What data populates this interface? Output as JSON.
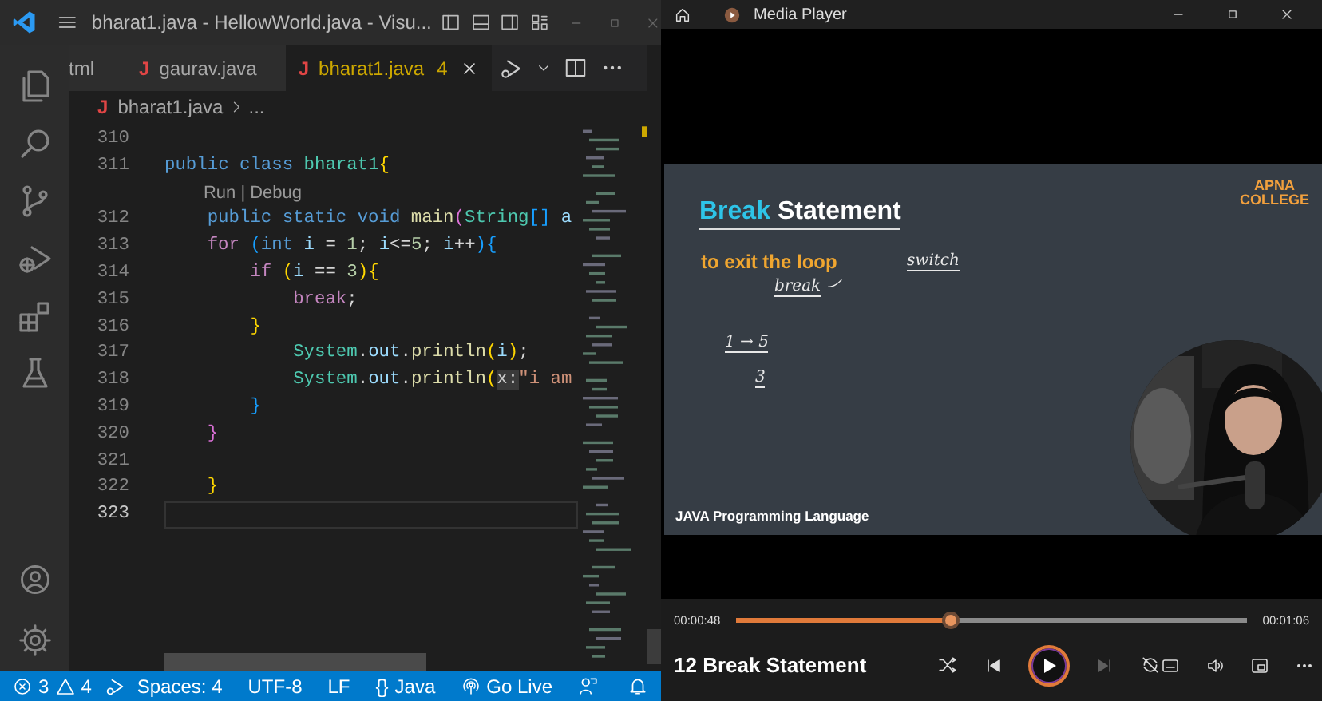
{
  "editor": {
    "title": "bharat1.java - HellowWorld.java - Visu...",
    "tabs": [
      {
        "label": "tml",
        "selected": false
      },
      {
        "icon": "J",
        "label": "gaurav.java",
        "selected": false
      },
      {
        "icon": "J",
        "label": "bharat1.java",
        "badge": "4",
        "selected": true
      }
    ],
    "breadcrumb": {
      "icon": "J",
      "file": "bharat1.java",
      "rest": "..."
    },
    "lines": [
      {
        "number": "310",
        "current": false
      },
      {
        "number": "311",
        "current": false,
        "tokens": [
          {
            "kind": "keyword",
            "text": "public class "
          },
          {
            "kind": "type",
            "text": "bharat1"
          },
          {
            "kind": "bracket1",
            "text": "{"
          }
        ],
        "children": [
          {
            "kind": "codelens",
            "text": "Run | Debug"
          },
          {
            "number": "312",
            "current": false,
            "tokens": [
              {
                "kind": "keyword",
                "text": "public static void "
              },
              {
                "kind": "function",
                "text": "main"
              },
              {
                "kind": "bracket2",
                "text": "("
              },
              {
                "kind": "type",
                "text": "String"
              },
              {
                "kind": "bracket3",
                "text": "[]"
              },
              {
                "kind": "variable",
                "text": " a"
              }
            ]
          },
          {
            "number": "313",
            "current": false,
            "tokens": [
              {
                "kind": "control",
                "text": "for "
              },
              {
                "kind": "bracket3",
                "text": "("
              },
              {
                "kind": "keyword",
                "text": "int"
              },
              {
                "kind": "variable",
                "text": " i"
              },
              {
                "kind": "plain",
                "text": " = "
              },
              {
                "kind": "number",
                "text": "1"
              },
              {
                "kind": "plain",
                "text": "; "
              },
              {
                "kind": "variable",
                "text": "i"
              },
              {
                "kind": "plain",
                "text": "<="
              },
              {
                "kind": "number",
                "text": "5"
              },
              {
                "kind": "plain",
                "text": "; "
              },
              {
                "kind": "variable",
                "text": "i"
              },
              {
                "kind": "plain",
                "text": "++"
              },
              {
                "kind": "bracket3",
                "text": "){"
              }
            ],
            "children": [
              {
                "number": "314",
                "current": false,
                "tokens": [
                  {
                    "kind": "control",
                    "text": "if "
                  },
                  {
                    "kind": "bracket1",
                    "text": "("
                  },
                  {
                    "kind": "variable",
                    "text": "i"
                  },
                  {
                    "kind": "plain",
                    "text": " == "
                  },
                  {
                    "kind": "number",
                    "text": "3"
                  },
                  {
                    "kind": "bracket1",
                    "text": "){"
                  }
                ],
                "children": [
                  {
                    "number": "315",
                    "current": false,
                    "tokens": [
                      {
                        "kind": "control",
                        "text": "break"
                      },
                      {
                        "kind": "plain",
                        "text": ";"
                      }
                    ]
                  }
                ]
              },
              {
                "number": "316",
                "current": false,
                "tokens": [
                  {
                    "kind": "bracket1",
                    "text": "}"
                  }
                ],
                "children": [
                  {
                    "number": "317",
                    "current": false,
                    "tokens": [
                      {
                        "kind": "type",
                        "text": "System"
                      },
                      {
                        "kind": "plain",
                        "text": "."
                      },
                      {
                        "kind": "variable",
                        "text": "out"
                      },
                      {
                        "kind": "plain",
                        "text": "."
                      },
                      {
                        "kind": "function",
                        "text": "println"
                      },
                      {
                        "kind": "bracket1",
                        "text": "("
                      },
                      {
                        "kind": "variable",
                        "text": "i"
                      },
                      {
                        "kind": "bracket1",
                        "text": ")"
                      },
                      {
                        "kind": "plain",
                        "text": ";"
                      }
                    ]
                  },
                  {
                    "number": "318",
                    "current": false,
                    "tokens": [
                      {
                        "kind": "type",
                        "text": "System"
                      },
                      {
                        "kind": "plain",
                        "text": "."
                      },
                      {
                        "kind": "variable",
                        "text": "out"
                      },
                      {
                        "kind": "plain",
                        "text": "."
                      },
                      {
                        "kind": "function",
                        "text": "println"
                      },
                      {
                        "kind": "bracket1",
                        "text": "("
                      },
                      {
                        "kind": "hint",
                        "text": "x:"
                      },
                      {
                        "kind": "string",
                        "text": "\"i am"
                      }
                    ]
                  }
                ]
              },
              {
                "number": "319",
                "current": false,
                "tokens": [
                  {
                    "kind": "bracket3",
                    "text": "}"
                  }
                ]
              }
            ]
          },
          {
            "number": "320",
            "current": false,
            "tokens": [
              {
                "kind": "bracket2",
                "text": "}"
              }
            ]
          },
          {
            "number": "321",
            "current": false
          },
          {
            "number": "322",
            "current": false,
            "tokens": [
              {
                "kind": "bracket1",
                "text": "}"
              }
            ]
          }
        ]
      },
      {
        "number": "323",
        "current": true
      }
    ],
    "status_bar": {
      "errors": "3",
      "warnings": "4",
      "items": [
        {
          "kind": "text",
          "text": "Spaces: 4"
        },
        {
          "kind": "text",
          "text": "UTF-8"
        },
        {
          "kind": "text",
          "text": "LF"
        },
        {
          "kind": "language",
          "icon": "{}",
          "text": "Java"
        },
        {
          "kind": "live",
          "text": "Go Live"
        }
      ]
    }
  },
  "player": {
    "title": "Media Player",
    "slide": {
      "title_highlight": "Break",
      "title_rest": "Statement",
      "subtitle": "to exit the loop",
      "logo_top": "APNA",
      "logo_bottom": "COLLEGE",
      "footer": "JAVA Programming Language",
      "handwriting": [
        {
          "text": "break",
          "underlined": true
        },
        {
          "text": "switch",
          "underlined": true
        },
        {
          "text": "1 → 5",
          "underlined": true
        },
        {
          "text": "3",
          "underlined": true
        }
      ]
    },
    "elapsed": "00:00:48",
    "total": "00:01:06",
    "level": 0.42,
    "track": "12 Break Statement",
    "playing": false,
    "next_disabled": true
  }
}
